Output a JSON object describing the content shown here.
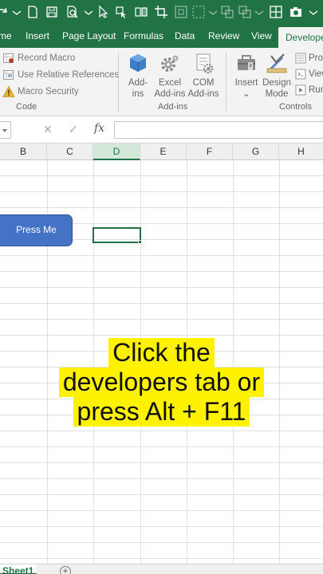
{
  "tabs": [
    {
      "label": "me",
      "active": false
    },
    {
      "label": "Insert",
      "active": false
    },
    {
      "label": "Page Layout",
      "active": false
    },
    {
      "label": "Formulas",
      "active": false
    },
    {
      "label": "Data",
      "active": false
    },
    {
      "label": "Review",
      "active": false
    },
    {
      "label": "View",
      "active": false
    },
    {
      "label": "Develope",
      "active": true
    }
  ],
  "ribbon": {
    "code": {
      "record_macro": "Record Macro",
      "relative_refs": "Use Relative References",
      "macro_security": "Macro Security",
      "group_label": "Code"
    },
    "addins": {
      "addins_line1": "Add-",
      "addins_line2": "ins",
      "excel_line1": "Excel",
      "excel_line2": "Add-ins",
      "com_line1": "COM",
      "com_line2": "Add-ins",
      "group_label": "Add-ins"
    },
    "controls": {
      "insert": "Insert",
      "insert_arrow": "⌄",
      "design_line1": "Design",
      "design_line2": "Mode",
      "properties": "Prop",
      "view_code": "View",
      "run_dialog": "Run",
      "group_label": "Controls"
    }
  },
  "formula_bar": {
    "cancel": "✕",
    "enter": "✓",
    "fx": "fx",
    "value": ""
  },
  "columns": [
    "B",
    "C",
    "D",
    "E",
    "F",
    "G",
    "H"
  ],
  "selected_column": "D",
  "button_label": "Press Me",
  "caption": {
    "line1": "Click the",
    "line2": "developers tab or",
    "line3": "press Alt + F11"
  },
  "sheet": {
    "tab": "Sheet1",
    "add": "+"
  },
  "colors": {
    "excel_green": "#217346",
    "button_blue": "#4472c4",
    "highlight_yellow": "#fff200"
  }
}
